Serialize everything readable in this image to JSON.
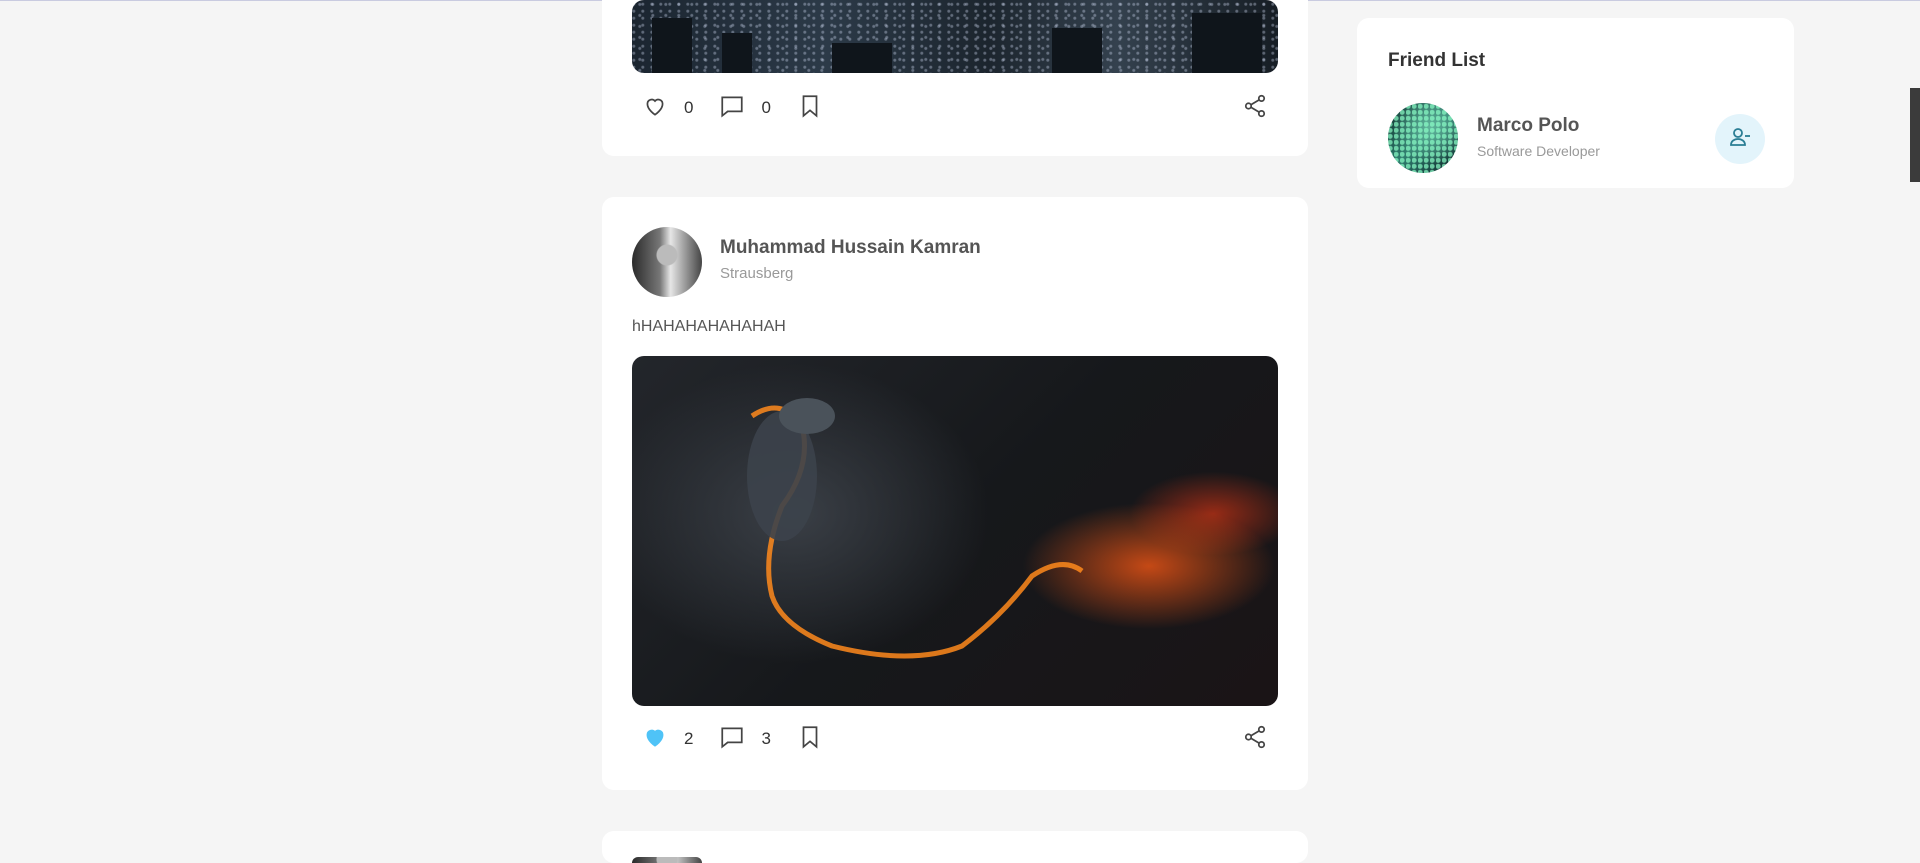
{
  "feed": {
    "posts": [
      {
        "likes": "0",
        "comments": "0",
        "liked": false
      },
      {
        "author": "Muhammad Hussain Kamran",
        "location": "Strausberg",
        "text": "hHAHAHAHAHAHAH",
        "likes": "2",
        "comments": "3",
        "liked": true
      }
    ]
  },
  "friend_list": {
    "title": "Friend List",
    "friends": [
      {
        "name": "Marco Polo",
        "role": "Software Developer"
      }
    ]
  },
  "colors": {
    "liked_heart": "#4fc3f7",
    "unfriend_bg": "#e3f4fb",
    "unfriend_icon": "#2a7d94"
  },
  "icons": [
    "heart-icon",
    "comment-icon",
    "bookmark-icon",
    "share-icon",
    "user-minus-icon"
  ]
}
